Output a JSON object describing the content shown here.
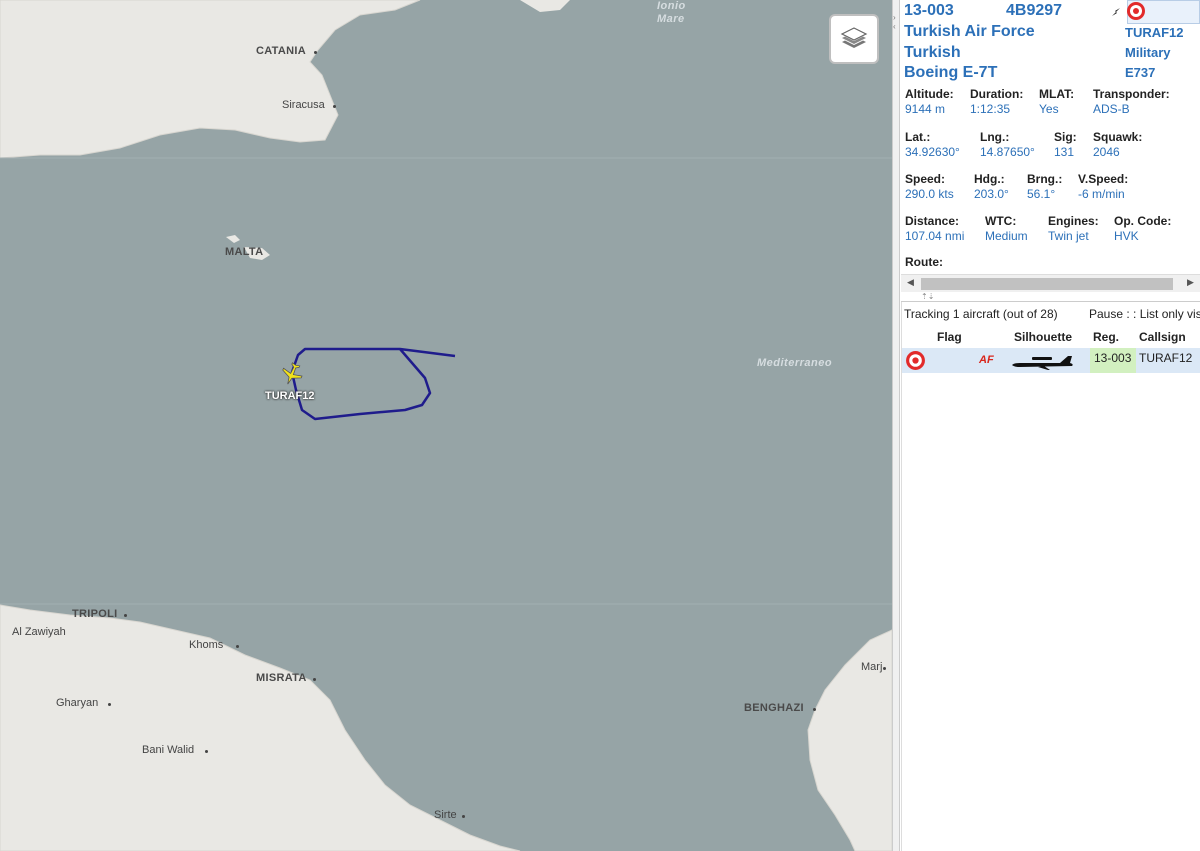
{
  "map": {
    "cities": [
      {
        "name": "CATANIA"
      },
      {
        "name": "MALTA"
      },
      {
        "name": "TRIPOLI"
      },
      {
        "name": "MISRATA"
      },
      {
        "name": "BENGHAZI"
      }
    ],
    "towns": [
      "Siracusa",
      "Al Zawiyah",
      "Khoms",
      "Gharyan",
      "Bani Walid",
      "Sirte",
      "Marj"
    ],
    "seas": [
      "Ionio",
      "Mare",
      "Mediterraneo"
    ],
    "plane_callsign": "TURAF12",
    "colors": {
      "water": "#96a4a6",
      "land": "#e9e8e4",
      "track": "#1f1c8c",
      "plane": "#f2e21a"
    },
    "layers_icon": "layers-icon"
  },
  "info": {
    "registration": "13-003",
    "icao": "4B9297",
    "operator": "Turkish Air Force",
    "country": "Turkish",
    "aircraft": "Boeing E-7T",
    "callsign": "TURAF12",
    "category": "Military",
    "type_code": "E737",
    "fields": {
      "altitude": {
        "label": "Altitude:",
        "value": "9144 m"
      },
      "duration": {
        "label": "Duration:",
        "value": "1:12:35"
      },
      "mlat": {
        "label": "MLAT:",
        "value": "Yes"
      },
      "transponder": {
        "label": "Transponder:",
        "value": "ADS-B"
      },
      "lat": {
        "label": "Lat.:",
        "value": "34.92630°"
      },
      "lng": {
        "label": "Lng.:",
        "value": "14.87650°"
      },
      "sig": {
        "label": "Sig:",
        "value": "131"
      },
      "squawk": {
        "label": "Squawk:",
        "value": "2046"
      },
      "speed": {
        "label": "Speed:",
        "value": "290.0 kts"
      },
      "hdg": {
        "label": "Hdg.:",
        "value": "203.0°"
      },
      "brng": {
        "label": "Brng.:",
        "value": "56.1°"
      },
      "vspeed": {
        "label": "V.Speed:",
        "value": "-6 m/min"
      },
      "distance": {
        "label": "Distance:",
        "value": "107.04 nmi"
      },
      "wtc": {
        "label": "WTC:",
        "value": "Medium"
      },
      "engines": {
        "label": "Engines:",
        "value": "Twin jet"
      },
      "opcode": {
        "label": "Op. Code:",
        "value": "HVK"
      },
      "route": {
        "label": "Route:",
        "value": ""
      }
    }
  },
  "list": {
    "status": "Tracking 1 aircraft (out of 28)",
    "pause": "Pause : : List only visi",
    "headers": {
      "flag": "Flag",
      "silhouette": "Silhouette",
      "reg": "Reg.",
      "callsign": "Callsign"
    },
    "rows": [
      {
        "af": "AF",
        "reg": "13-003",
        "callsign": "TURAF12"
      }
    ]
  }
}
